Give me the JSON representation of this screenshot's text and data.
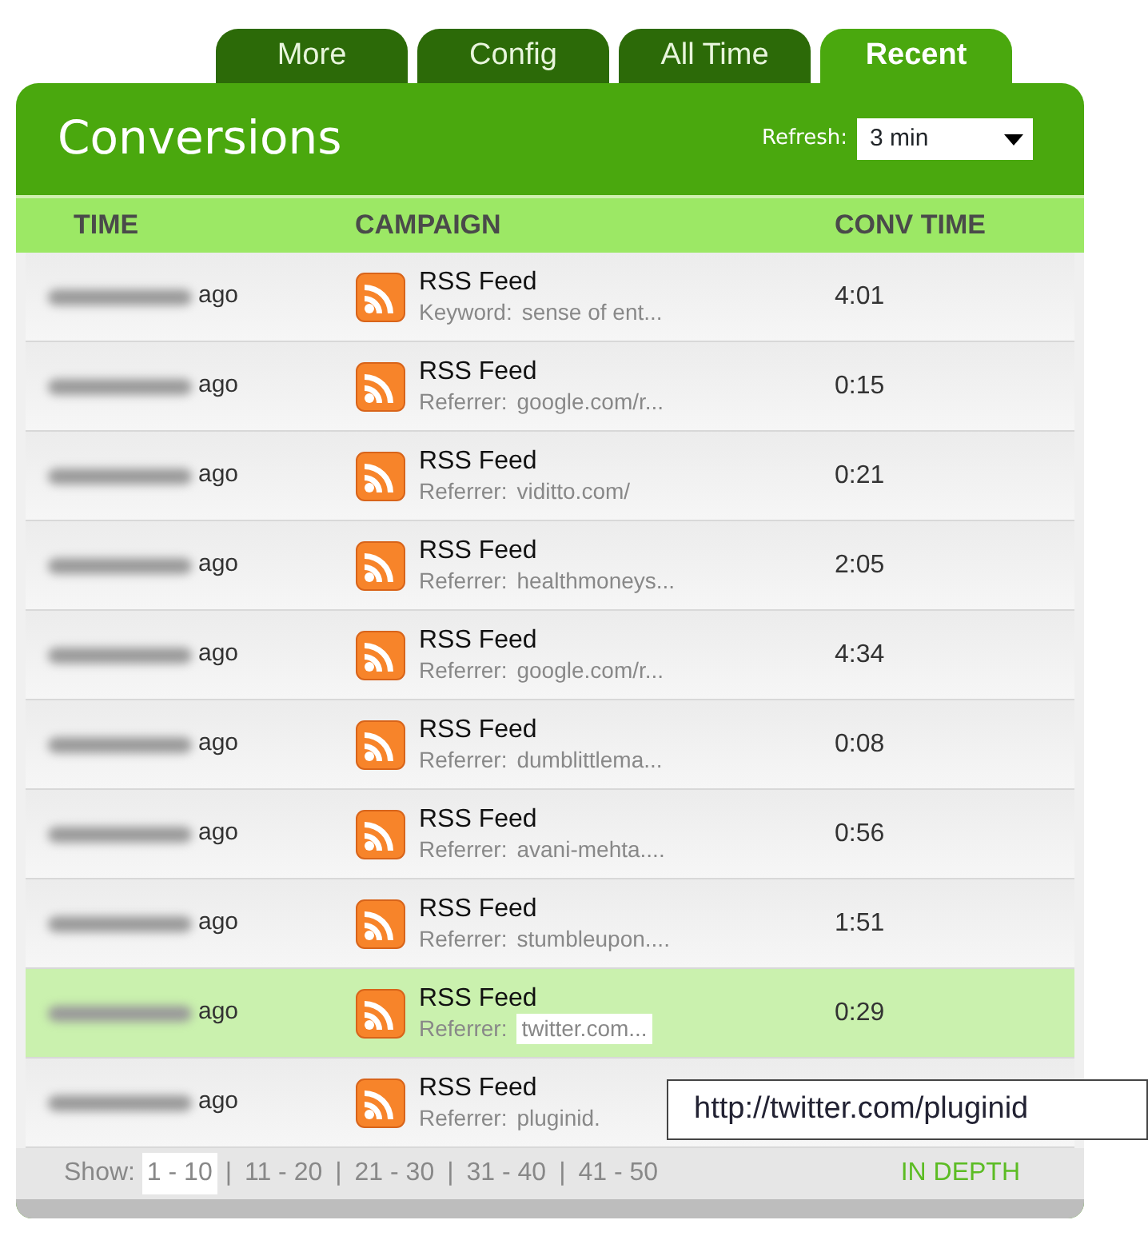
{
  "tabs": [
    {
      "label": "More",
      "selected": false
    },
    {
      "label": "Config",
      "selected": false
    },
    {
      "label": "All Time",
      "selected": false
    },
    {
      "label": "Recent",
      "selected": true
    }
  ],
  "panel": {
    "title": "Conversions",
    "refresh_label": "Refresh:",
    "refresh_value": "3 min"
  },
  "table": {
    "columns": [
      "TIME",
      "CAMPAIGN",
      "CONV TIME"
    ],
    "rows": [
      {
        "time_suffix": "ago",
        "campaign": "RSS Feed",
        "detail_label": "Keyword:",
        "detail_value": "sense of ent...",
        "conv_time": "4:01",
        "selected": false
      },
      {
        "time_suffix": "ago",
        "campaign": "RSS Feed",
        "detail_label": "Referrer:",
        "detail_value": "google.com/r...",
        "conv_time": "0:15",
        "selected": false
      },
      {
        "time_suffix": "ago",
        "campaign": "RSS Feed",
        "detail_label": "Referrer:",
        "detail_value": "viditto.com/",
        "conv_time": "0:21",
        "selected": false
      },
      {
        "time_suffix": "ago",
        "campaign": "RSS Feed",
        "detail_label": "Referrer:",
        "detail_value": "healthmoneys...",
        "conv_time": "2:05",
        "selected": false
      },
      {
        "time_suffix": "ago",
        "campaign": "RSS Feed",
        "detail_label": "Referrer:",
        "detail_value": "google.com/r...",
        "conv_time": "4:34",
        "selected": false
      },
      {
        "time_suffix": "ago",
        "campaign": "RSS Feed",
        "detail_label": "Referrer:",
        "detail_value": "dumblittlema...",
        "conv_time": "0:08",
        "selected": false
      },
      {
        "time_suffix": "ago",
        "campaign": "RSS Feed",
        "detail_label": "Referrer:",
        "detail_value": "avani-mehta....",
        "conv_time": "0:56",
        "selected": false
      },
      {
        "time_suffix": "ago",
        "campaign": "RSS Feed",
        "detail_label": "Referrer:",
        "detail_value": "stumbleupon....",
        "conv_time": "1:51",
        "selected": false
      },
      {
        "time_suffix": "ago",
        "campaign": "RSS Feed",
        "detail_label": "Referrer:",
        "detail_value": "twitter.com...",
        "conv_time": "0:29",
        "selected": true
      },
      {
        "time_suffix": "ago",
        "campaign": "RSS Feed",
        "detail_label": "Referrer:",
        "detail_value": "pluginid.",
        "selected": false
      }
    ]
  },
  "footer": {
    "show_label": "Show:",
    "pages": [
      {
        "label": "1 - 10",
        "selected": true
      },
      {
        "label": "11 - 20",
        "selected": false
      },
      {
        "label": "21 - 30",
        "selected": false
      },
      {
        "label": "31 - 40",
        "selected": false
      },
      {
        "label": "41 - 50",
        "selected": false
      }
    ],
    "separator": "|",
    "in_depth": "IN DEPTH"
  },
  "tooltip": {
    "text": "http://twitter.com/pluginid"
  }
}
